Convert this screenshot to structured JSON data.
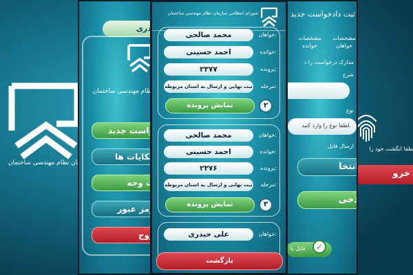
{
  "phone1": {
    "caption": "سازمان نظام مهندسی ساختمان"
  },
  "phone2": {
    "user_button": "حیدری",
    "org_title": "نظام مهندسی ساختمان",
    "menu": [
      {
        "label": "واست جدید"
      },
      {
        "label": "مکایات ها"
      },
      {
        "label": "ت وجه"
      },
      {
        "label": "رمز عبور"
      },
      {
        "label": "روج"
      }
    ]
  },
  "phone3": {
    "header_line1": "شورای انتظامی سازمان نظام مهندسی ساختمان",
    "labels": {
      "applicant": "خواهان:",
      "respondent": "خوانده:",
      "case": "پرونده:",
      "stage": "مرحله:"
    },
    "show_label": "نمایش پرونده",
    "cards": [
      {
        "applicant": "محمد صالحی",
        "respondent": "احمد حسینی",
        "case": "۲۳۷۷",
        "stage": "ثبت نهایی و ارسال به استان مربوطه",
        "number": "۲"
      },
      {
        "applicant": "محمد صالحی",
        "respondent": "احمد حسینی",
        "case": "۲۳۷۶",
        "stage": "ثبت نهایی و ارسال به استان مربوطه",
        "number": "۳"
      },
      {
        "applicant": "علی حیدری"
      }
    ],
    "back_label": "بازگشت"
  },
  "phone4": {
    "title": "ثبت دادخواست جدید",
    "tabs": [
      "مشخصات خواهان",
      "مشخصات خوانده",
      "مدارک درخواست"
    ],
    "docs_label": "مدارک درخواست را د",
    "desc_label": "شرح",
    "type_label": "نوع",
    "type_placeholder": "لطفا نوع را وارد کنید.",
    "file_label": "ارسال فایل",
    "select_button": "انتخا",
    "save_button": "ذخی",
    "file_check": "فایل با"
  },
  "phone5": {
    "fingerprint_caption": "لطفا انگشت خود را",
    "exit_button": "خرو"
  },
  "colors": {
    "green": "#4caf50",
    "red": "#d32f3a",
    "teal": "#1b8fa6"
  },
  "icons": {
    "logo": "org-logo-icon",
    "fingerprint": "fingerprint-icon",
    "check": "check-icon",
    "arrow": "chevron-right-icon"
  }
}
